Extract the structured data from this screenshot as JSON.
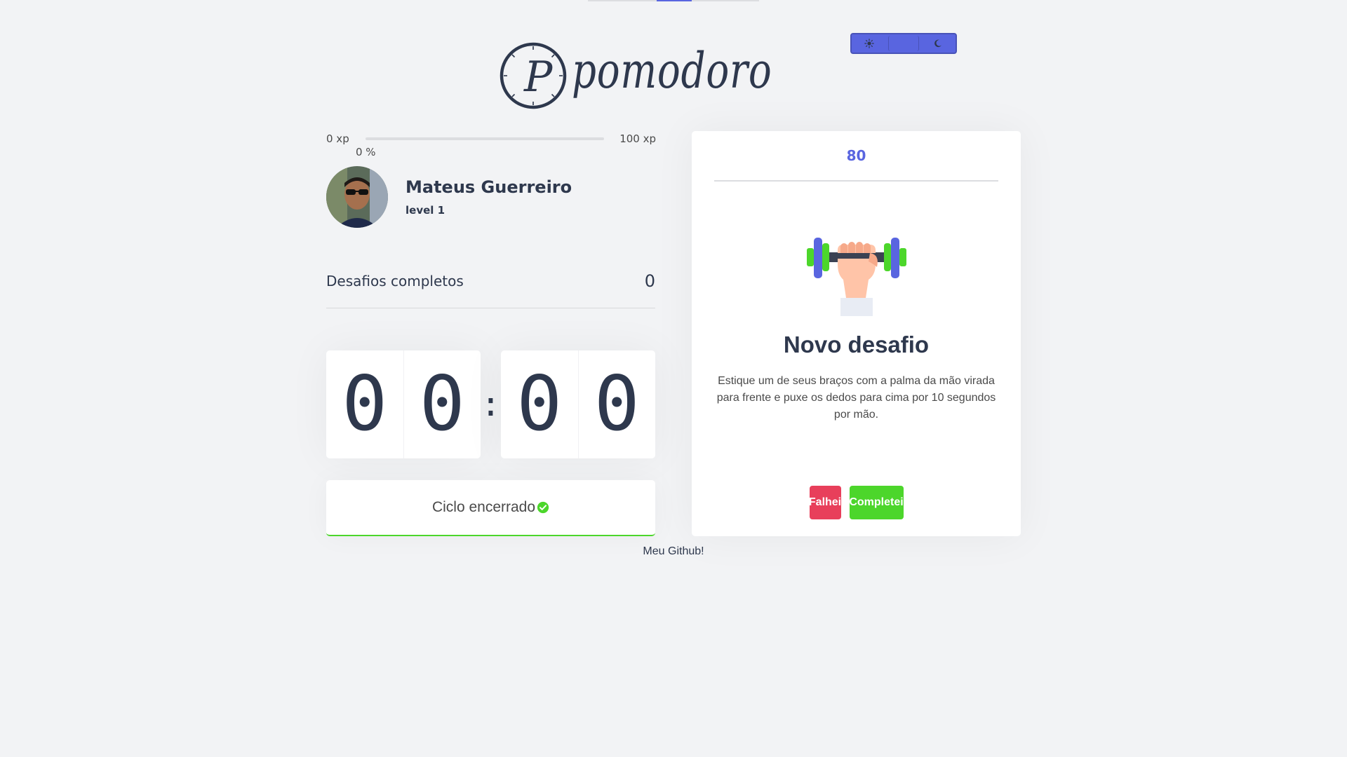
{
  "theme_switch": {
    "light_icon": "sun-icon",
    "dark_icon": "moon-icon"
  },
  "logo": {
    "letter": "P",
    "word": "pomodoro"
  },
  "experience": {
    "min_label": "0 xp",
    "max_label": "100 xp",
    "current_label": "0 %",
    "progress_fraction": 0.0
  },
  "profile": {
    "name": "Mateus Guerreiro",
    "level": "level 1"
  },
  "completed_challenges": {
    "label": "Desafios completos",
    "count": "0"
  },
  "countdown": {
    "minutes": [
      "0",
      "0"
    ],
    "separator": ":",
    "seconds": [
      "0",
      "0"
    ]
  },
  "cycle_button": {
    "label": "Ciclo encerrado",
    "icon": "check-circle-icon"
  },
  "challenge": {
    "xp_amount": "80",
    "icon": "dumbbell-icon",
    "title": "Novo desafio",
    "description": "Estique um de seus braços com a palma da mão virada para frente e puxe os dedos para cima por 10 segundos por mão.",
    "fail_label": "Falhei",
    "success_label": "Completei"
  },
  "footer": {
    "link_label": "Meu Github!"
  },
  "colors": {
    "accent": "#5965e0",
    "success": "#4cd62b",
    "danger": "#e83f5b",
    "background": "#f2f3f5",
    "text": "#2e384d"
  }
}
